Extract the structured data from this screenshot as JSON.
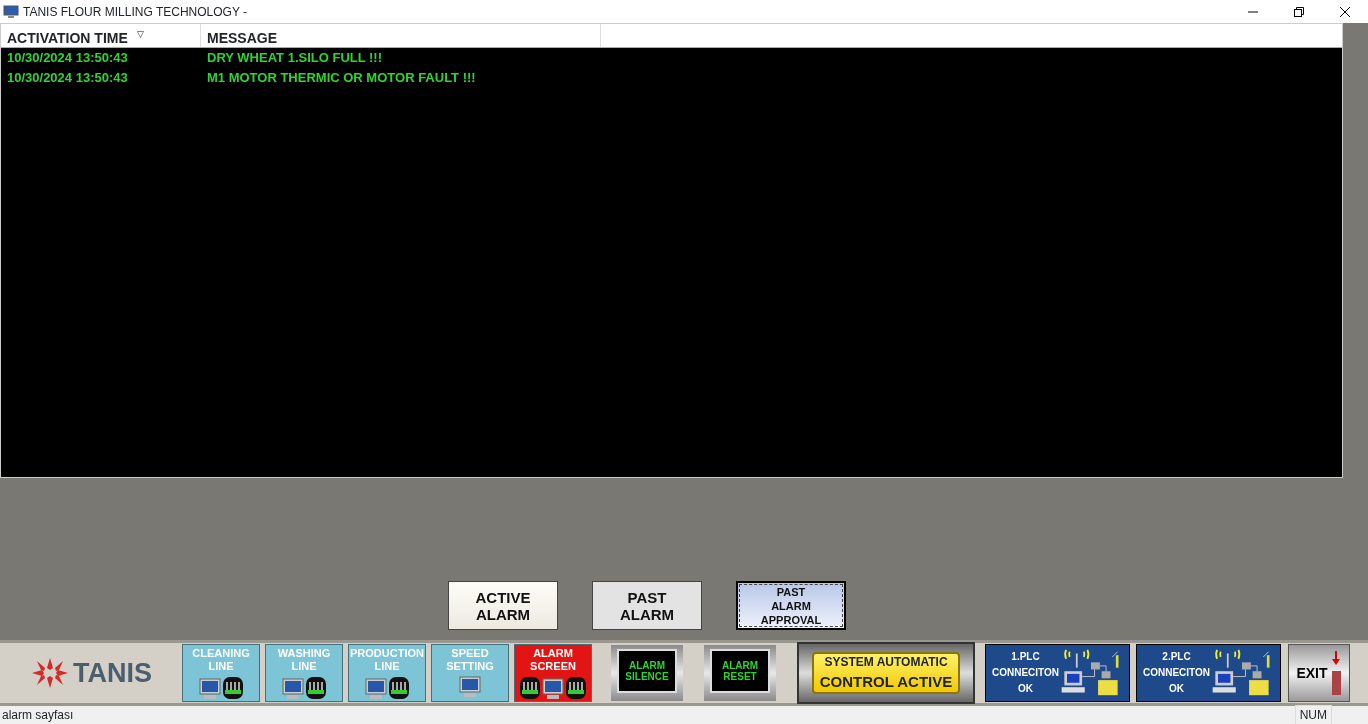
{
  "window": {
    "title": "TANIS FLOUR MILLING TECHNOLOGY -"
  },
  "table": {
    "columns": [
      {
        "label": "ACTIVATION TIME",
        "sort_indicator": "▽"
      },
      {
        "label": "MESSAGE"
      }
    ],
    "rows": [
      [
        "10/30/2024 13:50:43",
        "DRY WHEAT 1.SILO FULL !!!"
      ],
      [
        "10/30/2024 13:50:43",
        "M1 MOTOR THERMIC OR MOTOR FAULT !!!"
      ]
    ]
  },
  "view_buttons": [
    {
      "lines": [
        "ACTIVE",
        "ALARM"
      ],
      "kind": "active"
    },
    {
      "lines": [
        "PAST",
        "ALARM"
      ],
      "kind": "past"
    },
    {
      "lines": [
        "PAST",
        "ALARM",
        "APPROVAL"
      ],
      "kind": "approval"
    }
  ],
  "logo": {
    "text": "TANIS"
  },
  "nav_buttons": [
    {
      "lines": [
        "CLEANING",
        "LINE"
      ],
      "kind": "line",
      "selected": false
    },
    {
      "lines": [
        "WASHING",
        "LINE"
      ],
      "kind": "line",
      "selected": false
    },
    {
      "lines": [
        "PRODUCTION",
        "LINE"
      ],
      "kind": "line",
      "selected": false
    },
    {
      "lines": [
        "SPEED",
        "SETTING"
      ],
      "kind": "setting",
      "selected": false
    },
    {
      "lines": [
        "ALARM",
        "SCREEN"
      ],
      "kind": "alarm",
      "selected": true
    }
  ],
  "alarm_buttons": [
    {
      "lines": [
        "ALARM",
        "SILENCE"
      ]
    },
    {
      "lines": [
        "ALARM",
        "RESET"
      ]
    }
  ],
  "system_status": {
    "lines": [
      "SYSTEM AUTOMATIC",
      "CONTROL ACTIVE"
    ]
  },
  "plc_status": [
    {
      "lines": [
        "1.PLC",
        "CONNECITON",
        "OK"
      ]
    },
    {
      "lines": [
        "2.PLC",
        "CONNECITON",
        "OK"
      ]
    }
  ],
  "exit_button": {
    "label": "EXIT"
  },
  "status_bar": {
    "message": "alarm sayfası",
    "indicator": "NUM"
  }
}
